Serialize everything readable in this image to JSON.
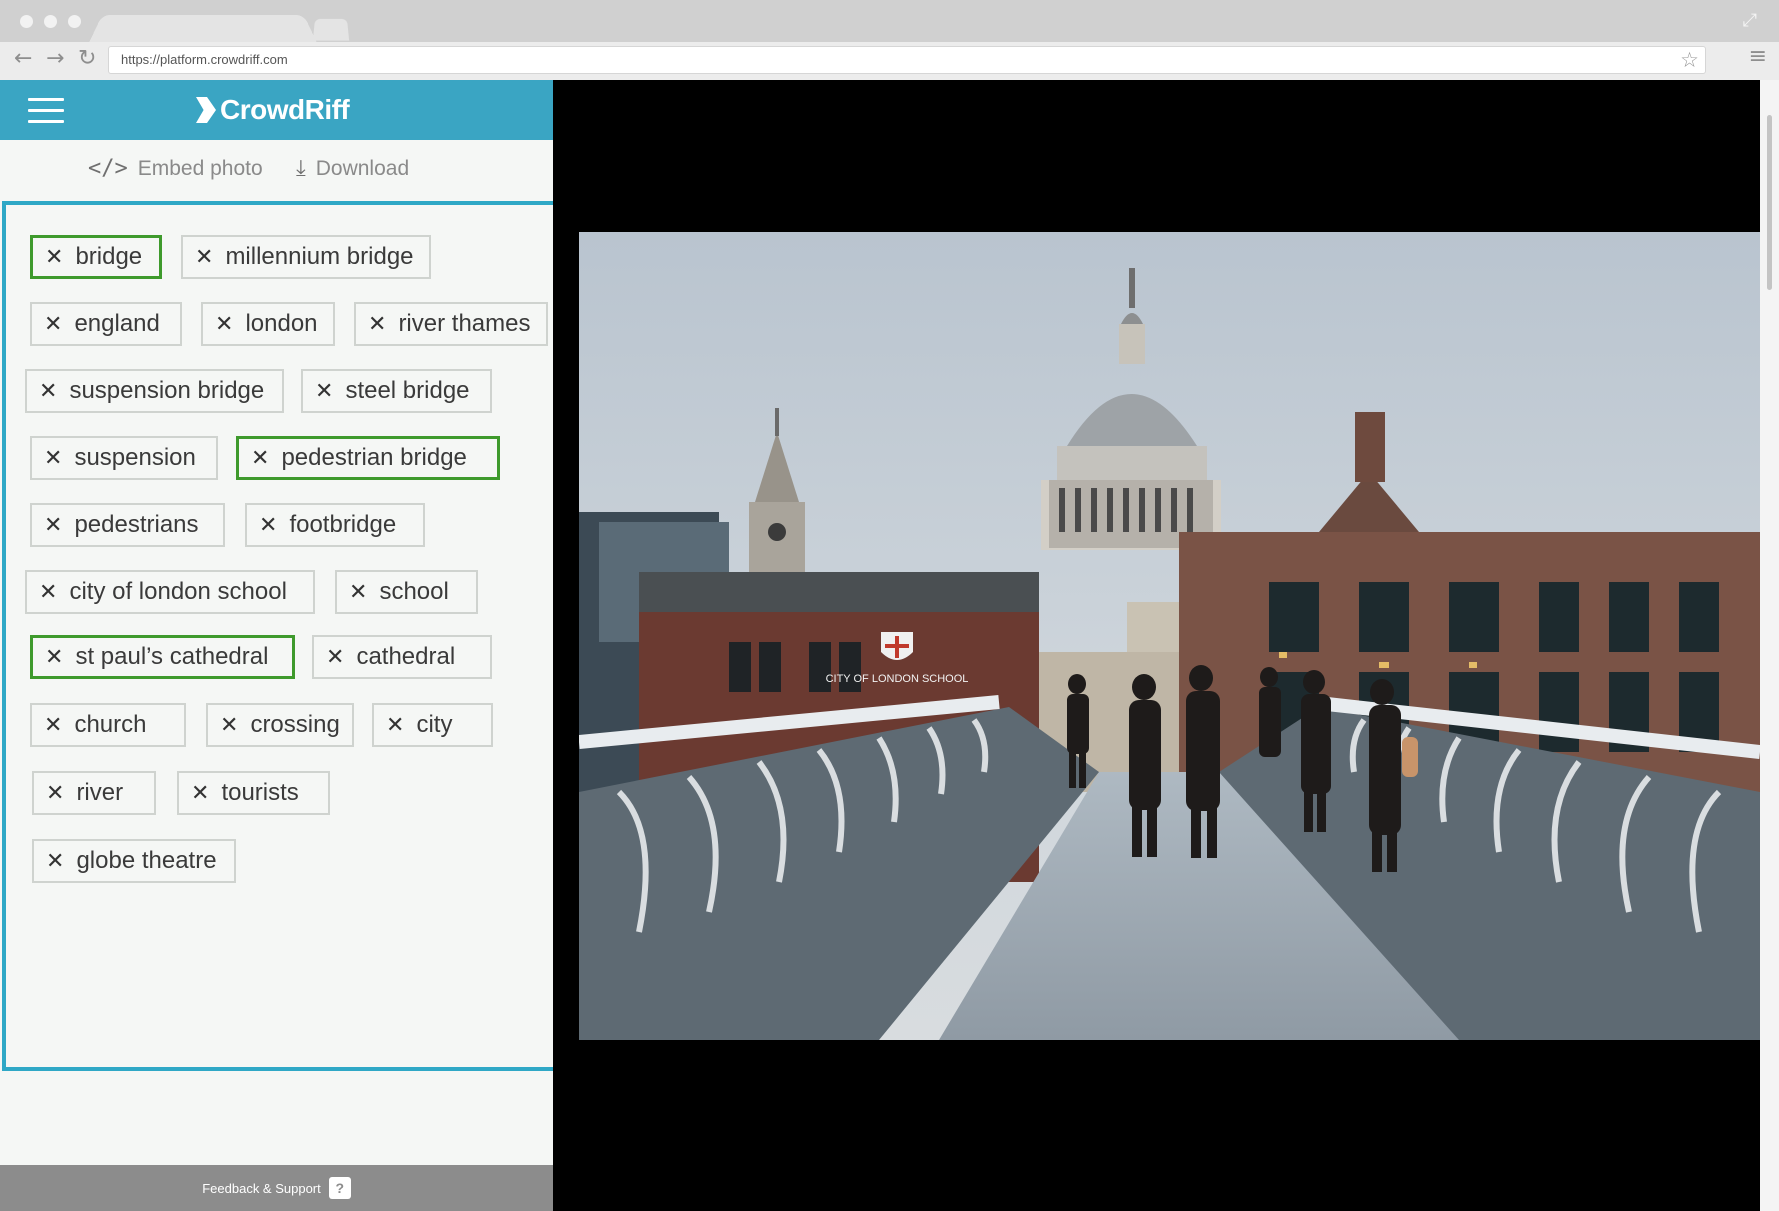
{
  "browser": {
    "url": "https://platform.crowdriff.com"
  },
  "app": {
    "brand": "CrowdRiff"
  },
  "actions": {
    "embed": "Embed photo",
    "download": "Download"
  },
  "tags": [
    {
      "label": "bridge",
      "selected": true
    },
    {
      "label": "millennium bridge",
      "selected": false
    },
    {
      "label": "england",
      "selected": false
    },
    {
      "label": "london",
      "selected": false
    },
    {
      "label": "river thames",
      "selected": false
    },
    {
      "label": "suspension bridge",
      "selected": false
    },
    {
      "label": "steel bridge",
      "selected": false
    },
    {
      "label": "suspension",
      "selected": false
    },
    {
      "label": "pedestrian bridge",
      "selected": true
    },
    {
      "label": "pedestrians",
      "selected": false
    },
    {
      "label": "footbridge",
      "selected": false
    },
    {
      "label": "city of london school",
      "selected": false
    },
    {
      "label": "school",
      "selected": false
    },
    {
      "label": "st paul’s cathedral",
      "selected": true
    },
    {
      "label": "cathedral",
      "selected": false
    },
    {
      "label": "church",
      "selected": false
    },
    {
      "label": "crossing",
      "selected": false
    },
    {
      "label": "city",
      "selected": false
    },
    {
      "label": "river",
      "selected": false
    },
    {
      "label": "tourists",
      "selected": false
    },
    {
      "label": "globe theatre",
      "selected": false
    }
  ],
  "footer": {
    "label": "Feedback & Support",
    "help": "?"
  },
  "photo": {
    "sign": "CITY OF LONDON SCHOOL"
  },
  "colors": {
    "accent": "#3aa5c3",
    "tag_border_selected": "#3e9a2c",
    "footer": "#8c8c8c"
  }
}
